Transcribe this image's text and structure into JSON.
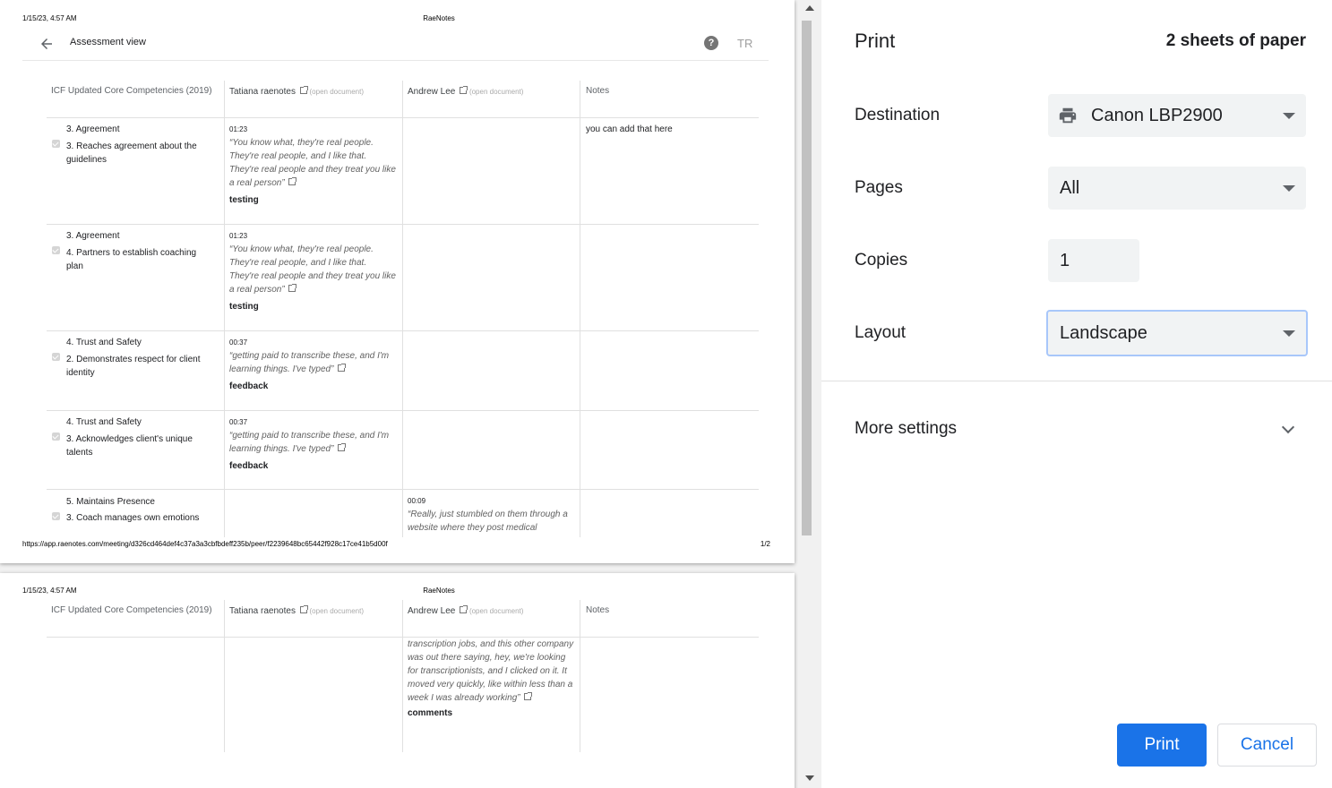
{
  "page1": {
    "date": "1/15/23, 4:57 AM",
    "title": "RaeNotes",
    "url": "https://app.raenotes.com/meeting/d326cd464def4c37a3a3cbfbdeff235b/peer/f2239648bc65442f928c17ce41b5d00f",
    "page_num": "1/2",
    "app_title": "Assessment view",
    "help": "?",
    "avatar": "TR"
  },
  "page2": {
    "date": "1/15/23, 4:57 AM",
    "title": "RaeNotes"
  },
  "grid_header": {
    "competencies": "ICF Updated Core Competencies (2019)",
    "person1": "Tatiana raenotes",
    "person2": "Andrew Lee",
    "open_doc": "(open document)",
    "notes": "Notes"
  },
  "rows": [
    {
      "category": "3. Agreement",
      "item": "3. Reaches agreement about the guidelines",
      "ts": "01:23",
      "quote": "“You know what, they're real people. They're real people, and I like that. They're real people and they treat you like a real person”",
      "tag": "testing",
      "note": "you can add that here"
    },
    {
      "category": "3. Agreement",
      "item": "4. Partners to establish coaching plan",
      "ts": "01:23",
      "quote": "“You know what, they're real people. They're real people, and I like that. They're real people and they treat you like a real person”",
      "tag": "testing",
      "note": ""
    },
    {
      "category": "4. Trust and Safety",
      "item": "2. Demonstrates respect for client identity",
      "ts": "00:37",
      "quote": "“getting paid to transcribe these, and I'm learning things. I've typed”",
      "tag": "feedback",
      "note": ""
    },
    {
      "category": "4. Trust and Safety",
      "item": "3. Acknowledges client's unique talents",
      "ts": "00:37",
      "quote": "“getting paid to transcribe these, and I'm learning things. I've typed”",
      "tag": "feedback",
      "note": ""
    },
    {
      "category": "5. Maintains Presence",
      "item": "3. Coach manages own emotions",
      "ts2": "00:09",
      "quote2": "“Really, just stumbled on them through a website where they post medical"
    }
  ],
  "page2_cont": {
    "quote": "transcription jobs, and this other company was out there saying, hey, we're looking for transcriptionists, and I clicked on it. It moved very quickly, like within less than a week I was already working”",
    "tag": "comments"
  },
  "panel": {
    "title": "Print",
    "sheets": "2 sheets of paper",
    "destination_label": "Destination",
    "destination_value": "Canon LBP2900",
    "pages_label": "Pages",
    "pages_value": "All",
    "copies_label": "Copies",
    "copies_value": "1",
    "layout_label": "Layout",
    "layout_value": "Landscape",
    "more_settings": "More settings",
    "print_button": "Print",
    "cancel_button": "Cancel"
  }
}
